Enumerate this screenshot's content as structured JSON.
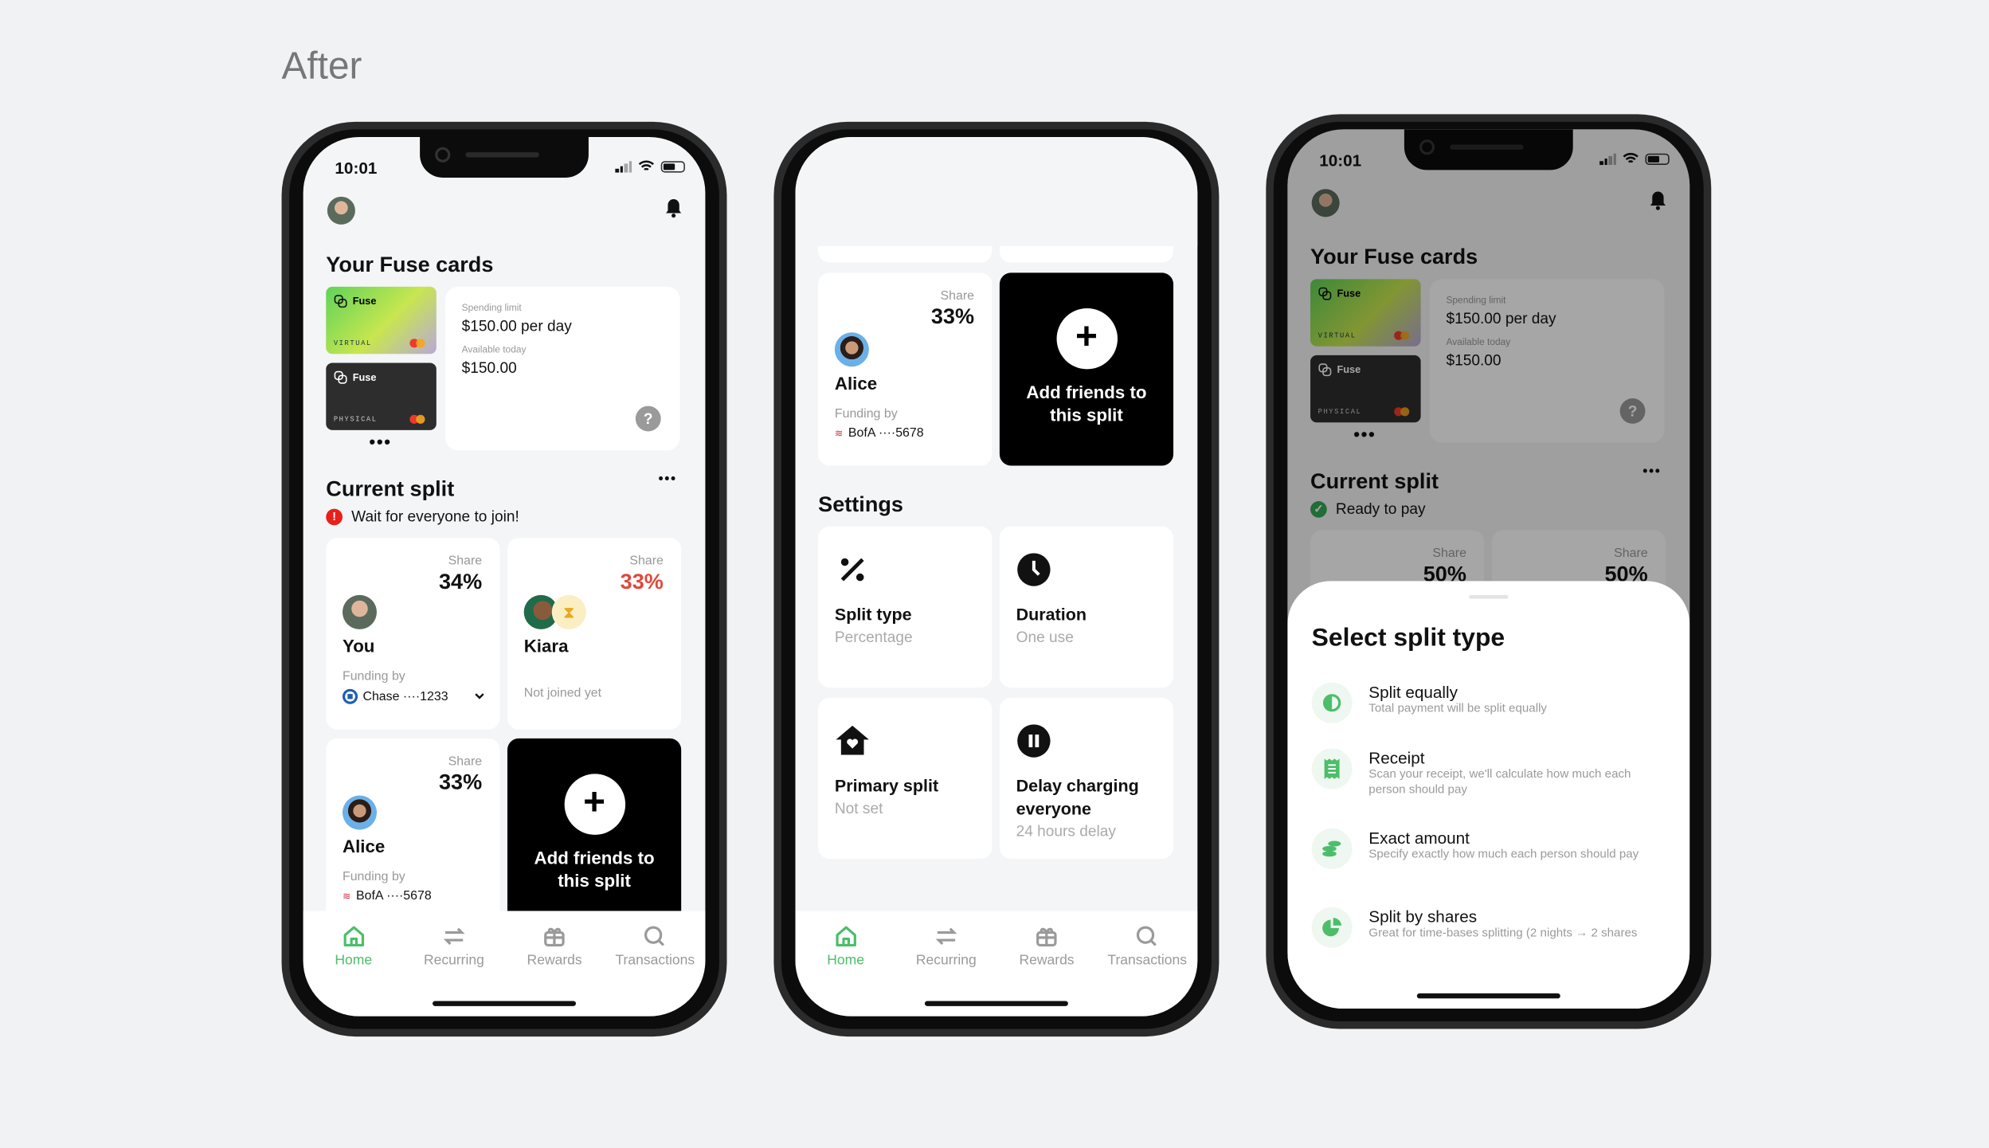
{
  "page_title": "After",
  "status_bar": {
    "time": "10:01"
  },
  "home": {
    "cards_heading": "Your Fuse cards",
    "virtual_card": {
      "brand": "Fuse",
      "type": "VIRTUAL"
    },
    "physical_card": {
      "brand": "Fuse",
      "type": "PHYSICAL"
    },
    "more_cards": "•••",
    "spending_limit_label": "Spending limit",
    "spending_limit_value": "$150.00 per day",
    "available_label": "Available today",
    "available_value": "$150.00",
    "help": "?",
    "split_heading": "Current split",
    "split_more": "•••",
    "status_wait": "Wait for everyone to join!",
    "status_ready": "Ready to pay",
    "share_label": "Share",
    "funding_label": "Funding by",
    "participants": [
      {
        "name": "You",
        "share": "34%",
        "bank": "Chase ····1233"
      },
      {
        "name": "Kiara",
        "share": "33%",
        "note": "Not joined yet"
      },
      {
        "name": "Alice",
        "share": "33%",
        "bank": "BofA ····5678"
      }
    ],
    "ready_shares": [
      "50%",
      "50%"
    ],
    "add_friends": "Add friends to this split"
  },
  "settings": {
    "heading": "Settings",
    "items": [
      {
        "icon": "percent-icon",
        "title": "Split type",
        "value": "Percentage"
      },
      {
        "icon": "clock-icon",
        "title": "Duration",
        "value": "One use"
      },
      {
        "icon": "house-heart-icon",
        "title": "Primary split",
        "value": "Not set"
      },
      {
        "icon": "pause-icon",
        "title": "Delay charging everyone",
        "value": "24 hours delay"
      }
    ]
  },
  "sheet": {
    "title": "Select split type",
    "options": [
      {
        "icon": "half-circle-icon",
        "title": "Split equally",
        "desc": "Total payment will be split equally"
      },
      {
        "icon": "receipt-icon",
        "title": "Receipt",
        "desc": "Scan your receipt, we'll calculate how much each person should pay"
      },
      {
        "icon": "coins-icon",
        "title": "Exact amount",
        "desc": "Specify exactly how much each person should pay"
      },
      {
        "icon": "pie-chart-icon",
        "title": "Split by shares",
        "desc": "Great for time-bases splitting (2 nights → 2 shares"
      }
    ]
  },
  "nav": [
    {
      "label": "Home",
      "icon": "home-icon",
      "active": true
    },
    {
      "label": "Recurring",
      "icon": "repeat-icon"
    },
    {
      "label": "Rewards",
      "icon": "gift-icon"
    },
    {
      "label": "Transactions",
      "icon": "search-icon"
    }
  ],
  "colors": {
    "accent": "#4cbe6a",
    "alert": "#e8201b",
    "pending_share": "#e0473a",
    "card_dark": "#2d2d2d"
  }
}
